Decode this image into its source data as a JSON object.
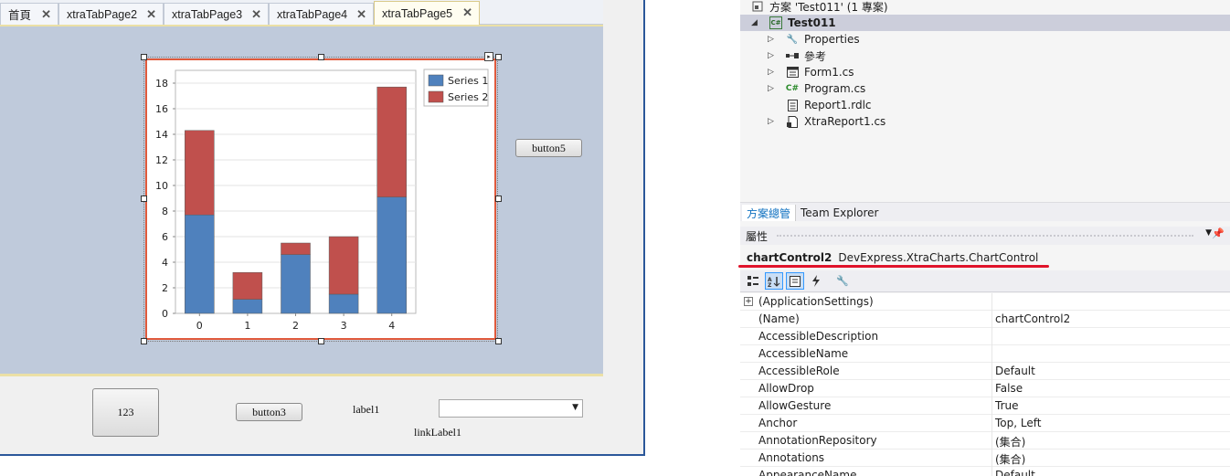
{
  "tabs": [
    {
      "label": "首頁",
      "active": false
    },
    {
      "label": "xtraTabPage2",
      "active": false
    },
    {
      "label": "xtraTabPage3",
      "active": false
    },
    {
      "label": "xtraTabPage4",
      "active": false
    },
    {
      "label": "xtraTabPage5",
      "active": true
    }
  ],
  "tab_close_glyph": "✕",
  "form": {
    "button5_label": "button5",
    "button_123_label": "123",
    "button3_label": "button3",
    "label1_text": "label1",
    "linklabel1_text": "linkLabel1",
    "combo_value": ""
  },
  "chart_data": {
    "type": "bar",
    "stacked": true,
    "categories": [
      "0",
      "1",
      "2",
      "3",
      "4"
    ],
    "series": [
      {
        "name": "Series 1",
        "color": "#4f81bd",
        "values": [
          7.7,
          1.1,
          4.6,
          1.5,
          9.1
        ]
      },
      {
        "name": "Series 2",
        "color": "#c0504d",
        "values": [
          6.6,
          2.1,
          0.9,
          4.5,
          8.6
        ]
      }
    ],
    "ylim": [
      0,
      19
    ],
    "yticks": [
      0,
      2,
      4,
      6,
      8,
      10,
      12,
      14,
      16,
      18
    ],
    "grid": true,
    "legend": "top-right"
  },
  "solution": {
    "header": "方案 'Test011' (1 專案)",
    "project": "Test011",
    "items": [
      {
        "label": "Properties",
        "icon": "wrench-icon",
        "expandable": true
      },
      {
        "label": "參考",
        "icon": "references-icon",
        "expandable": true
      },
      {
        "label": "Form1.cs",
        "icon": "form-icon",
        "expandable": true
      },
      {
        "label": "Program.cs",
        "icon": "csharp-file-icon",
        "expandable": true
      },
      {
        "label": "Report1.rdlc",
        "icon": "report-icon",
        "expandable": false
      },
      {
        "label": "XtraReport1.cs",
        "icon": "xtrareport-icon",
        "expandable": true
      }
    ]
  },
  "panel_tabs": [
    {
      "label": "方案總管",
      "active": true
    },
    {
      "label": "Team Explorer",
      "active": false
    }
  ],
  "properties": {
    "title": "屬性",
    "object_name": "chartControl2",
    "object_type": "DevExpress.XtraCharts.ChartControl",
    "rows": [
      {
        "name": "(ApplicationSettings)",
        "value": "",
        "expandable": true
      },
      {
        "name": "(Name)",
        "value": "chartControl2"
      },
      {
        "name": "AccessibleDescription",
        "value": ""
      },
      {
        "name": "AccessibleName",
        "value": ""
      },
      {
        "name": "AccessibleRole",
        "value": "Default"
      },
      {
        "name": "AllowDrop",
        "value": "False"
      },
      {
        "name": "AllowGesture",
        "value": "True"
      },
      {
        "name": "Anchor",
        "value": "Top, Left"
      },
      {
        "name": "AnnotationRepository",
        "value": "(集合)"
      },
      {
        "name": "Annotations",
        "value": "(集合)"
      },
      {
        "name": "AppearanceName",
        "value": "Default"
      }
    ]
  },
  "colors": {
    "accent_blue": "#2b579a",
    "selection_red": "#e0132a",
    "chart_border": "#e05a3c"
  }
}
